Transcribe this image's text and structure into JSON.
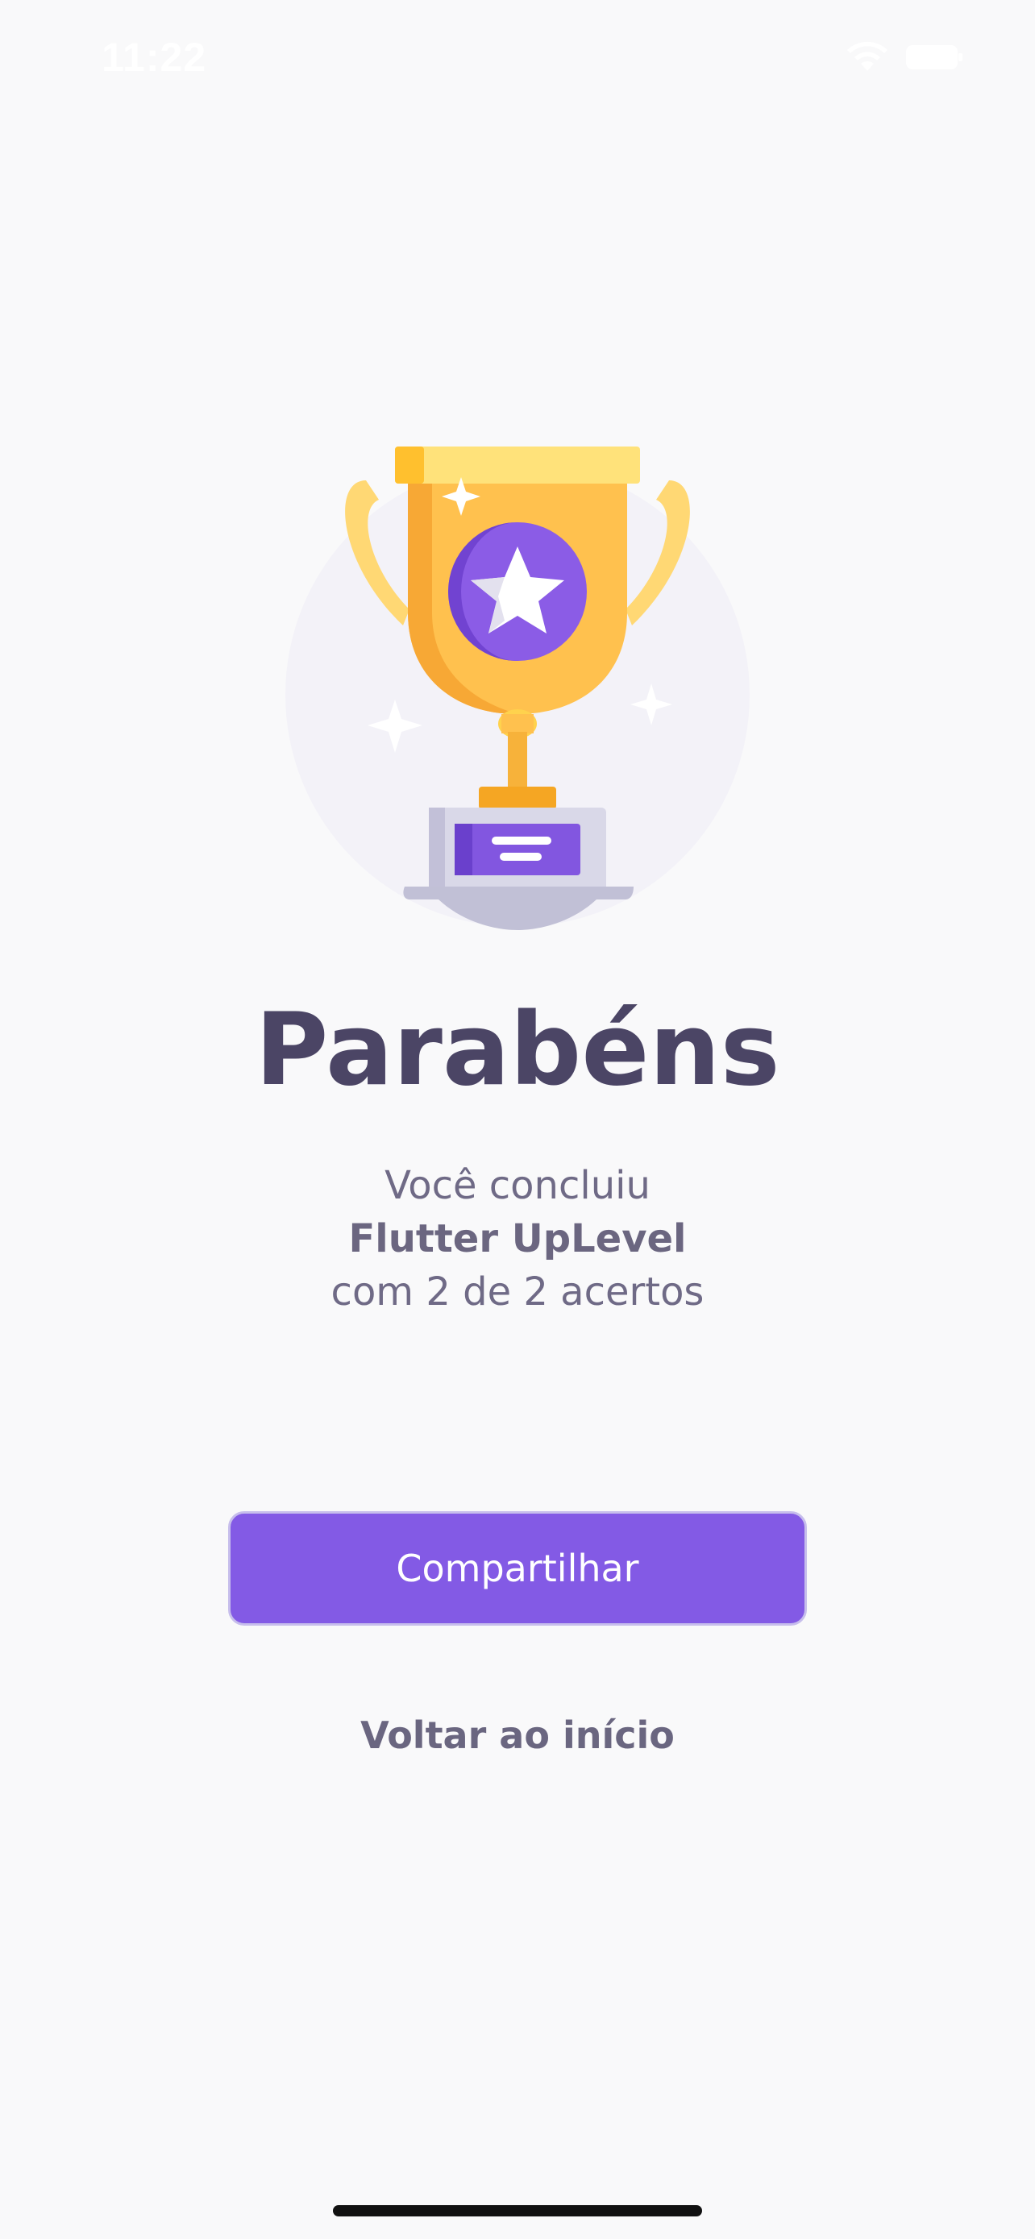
{
  "status_bar": {
    "time": "11:22",
    "icons": [
      "wifi-icon",
      "battery-icon"
    ]
  },
  "hero": {
    "icon": "trophy-icon"
  },
  "result": {
    "title": "Parabéns",
    "line1": "Você concluiu",
    "course_name": "Flutter UpLevel",
    "line3": "com 2 de 2 acertos"
  },
  "actions": {
    "share_label": "Compartilhar",
    "back_label": "Voltar ao início"
  },
  "colors": {
    "background": "#F9F9FA",
    "primary": "#835AE5",
    "title": "#4B4565",
    "text": "#6F6A86",
    "trophy_gold": "#FFC14E",
    "trophy_light": "#FFE27A"
  }
}
